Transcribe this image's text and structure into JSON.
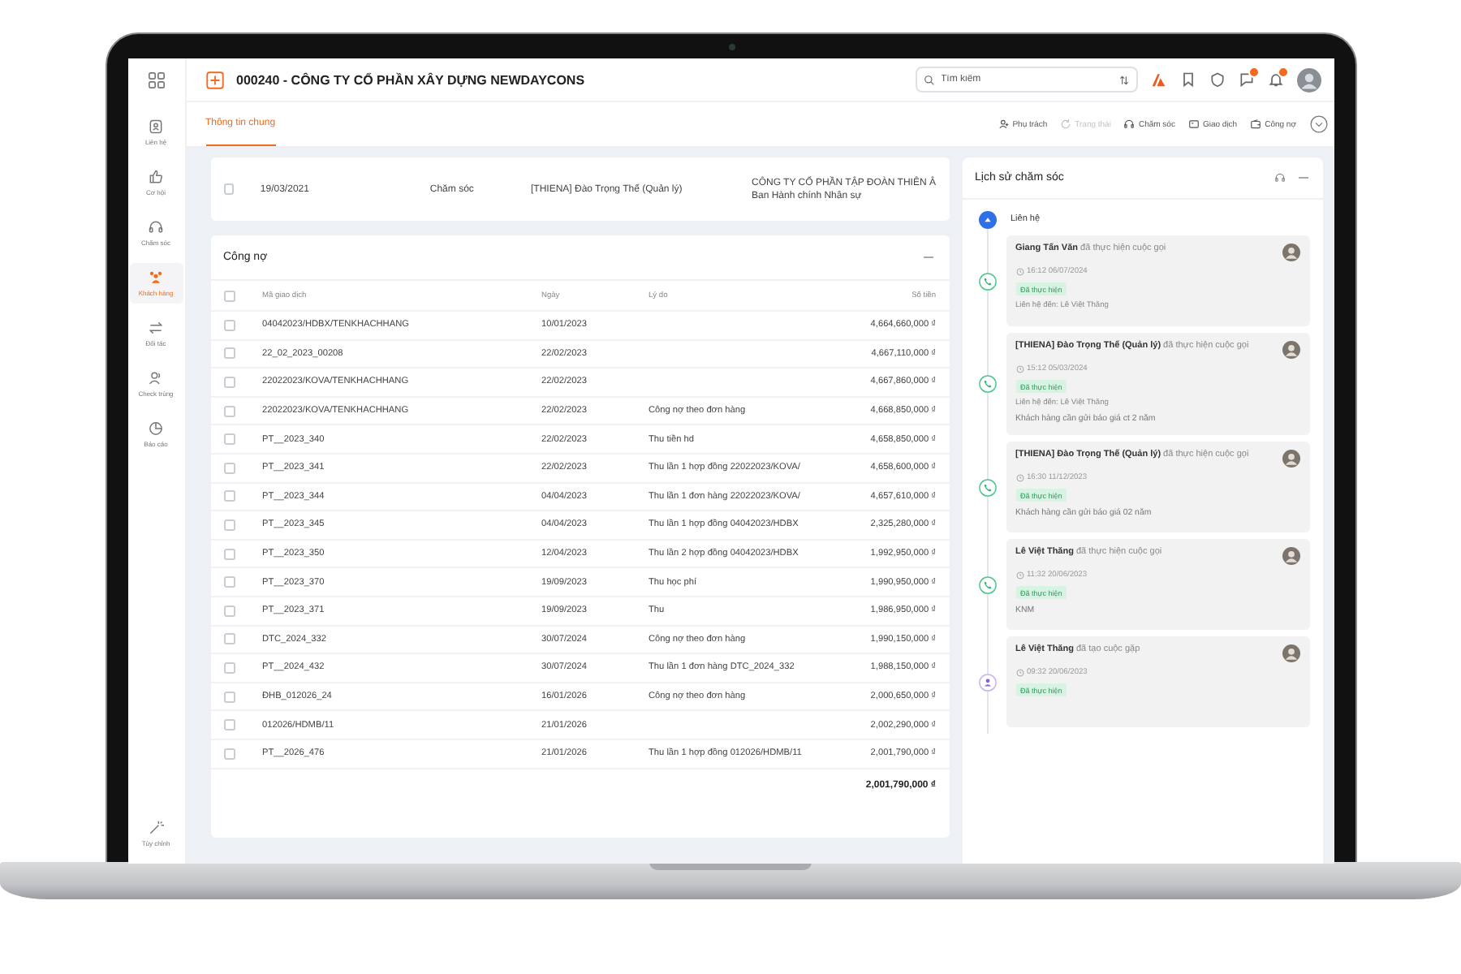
{
  "sidebar": {
    "items": [
      {
        "label": "Liên hệ",
        "kind": "contact",
        "selected": false
      },
      {
        "label": "Cơ hội",
        "kind": "like",
        "selected": false
      },
      {
        "label": "Chăm sóc",
        "kind": "headset",
        "selected": false
      },
      {
        "label": "Khách hàng",
        "kind": "people",
        "selected": true
      },
      {
        "label": "Đối tác",
        "kind": "swap",
        "selected": false
      },
      {
        "label": "Check trùng",
        "kind": "users",
        "selected": false
      },
      {
        "label": "Báo cáo",
        "kind": "chart",
        "selected": false
      }
    ],
    "bottom_item": {
      "label": "Tùy chỉnh"
    }
  },
  "header": {
    "title": "000240 - CÔNG TY CỔ PHẦN XÂY DỰNG NEWDAYCONS",
    "search": {
      "placeholder": "Tìm kiếm"
    }
  },
  "tabs": [
    {
      "label": "Thông tin chung",
      "selected": true
    }
  ],
  "actions": [
    {
      "label": "Phụ trách",
      "kind": "user",
      "disabled": false
    },
    {
      "label": "Trạng thái",
      "kind": "refresh",
      "disabled": true
    },
    {
      "label": "Chăm sóc",
      "kind": "headset",
      "disabled": false
    },
    {
      "label": "Giao dịch",
      "kind": "card",
      "disabled": false
    },
    {
      "label": "Công nợ",
      "kind": "wallet",
      "disabled": false
    }
  ],
  "summary_row": {
    "checked": false,
    "date": "19/03/2021",
    "type": "Chăm sóc",
    "owner": "[THIENA] Đào Trọng Thế (Quản lý)",
    "company": "CÔNG TY CỔ PHẦN TẬP ĐOÀN THIÊN Â",
    "department": "Ban Hành chính Nhân sự"
  },
  "debt": {
    "title": "Công nợ",
    "columns": [
      "Mã giao dịch",
      "Ngày",
      "Lý do",
      "Số tiền"
    ],
    "header_checked": false,
    "rows": [
      {
        "checked": false,
        "code": "04042023/HDBX/TENKHACHHANG",
        "date": "10/01/2023",
        "reason": "",
        "amount": "4,664,660,000 ₫"
      },
      {
        "checked": false,
        "code": "22_02_2023_00208",
        "date": "22/02/2023",
        "reason": "",
        "amount": "4,667,110,000 ₫"
      },
      {
        "checked": false,
        "code": "22022023/KOVA/TENKHACHHANG",
        "date": "22/02/2023",
        "reason": "",
        "amount": "4,667,860,000 ₫"
      },
      {
        "checked": false,
        "code": "22022023/KOVA/TENKHACHHANG",
        "date": "22/02/2023",
        "reason": "Công nợ theo đơn hàng",
        "amount": "4,668,850,000 ₫"
      },
      {
        "checked": false,
        "code": "PT__2023_340",
        "date": "22/02/2023",
        "reason": "Thu tiền hd",
        "amount": "4,658,850,000 ₫"
      },
      {
        "checked": false,
        "code": "PT__2023_341",
        "date": "22/02/2023",
        "reason": "Thu lần 1 hợp đồng 22022023/KOVA/",
        "amount": "4,658,600,000 ₫"
      },
      {
        "checked": false,
        "code": "PT__2023_344",
        "date": "04/04/2023",
        "reason": "Thu lần 1 đơn hàng 22022023/KOVA/",
        "amount": "4,657,610,000 ₫"
      },
      {
        "checked": false,
        "code": "PT__2023_345",
        "date": "04/04/2023",
        "reason": "Thu lần 1 hợp đồng 04042023/HDBX",
        "amount": "2,325,280,000 ₫"
      },
      {
        "checked": false,
        "code": "PT__2023_350",
        "date": "12/04/2023",
        "reason": "Thu lần 2 hợp đồng 04042023/HDBX",
        "amount": "1,992,950,000 ₫"
      },
      {
        "checked": false,
        "code": "PT__2023_370",
        "date": "19/09/2023",
        "reason": "Thu học phí",
        "amount": "1,990,950,000 ₫"
      },
      {
        "checked": false,
        "code": "PT__2023_371",
        "date": "19/09/2023",
        "reason": "Thu",
        "amount": "1,986,950,000 ₫"
      },
      {
        "checked": false,
        "code": "DTC_2024_332",
        "date": "30/07/2024",
        "reason": "Công nợ theo đơn hàng",
        "amount": "1,990,150,000 ₫"
      },
      {
        "checked": false,
        "code": "PT__2024_432",
        "date": "30/07/2024",
        "reason": "Thu lần 1 đơn hàng DTC_2024_332",
        "amount": "1,988,150,000 ₫"
      },
      {
        "checked": false,
        "code": "ĐHB_012026_24",
        "date": "16/01/2026",
        "reason": "Công nợ theo đơn hàng",
        "amount": "2,000,650,000 ₫"
      },
      {
        "checked": false,
        "code": "012026/HDMB/11",
        "date": "21/01/2026",
        "reason": "",
        "amount": "2,002,290,000 ₫"
      },
      {
        "checked": false,
        "code": "PT__2026_476",
        "date": "21/01/2026",
        "reason": "Thu lần 1 hợp đồng 012026/HDMB/11",
        "amount": "2,001,790,000 ₫"
      }
    ],
    "total": "2,001,790,000 ₫"
  },
  "history": {
    "title": "Lịch sử chăm sóc",
    "group": "Liên hệ",
    "entries": [
      {
        "kind": "call",
        "text": "**Giang Tấn Văn** đã thực hiện cuộc gọi",
        "time": "16:12 06/07/2024",
        "status": "Đã thực hiện",
        "contact": "Liên hệ đến: Lê Việt Thăng"
      },
      {
        "kind": "call",
        "text": "**[THIENA] Đào Trọng Thế (Quản lý)** đã thực hiện cuộc gọi",
        "time": "15:12 05/03/2024",
        "status": "Đã thực hiện",
        "contact": "Liên hệ đến: Lê Việt Thăng",
        "note": "Khách hàng cần gửi báo giá ct 2 năm"
      },
      {
        "kind": "call",
        "text": "**[THIENA] Đào Trọng Thế (Quản lý)** đã thực hiện cuộc gọi",
        "time": "16:30 11/12/2023",
        "status": "Đã thực hiện",
        "note": "Khách hàng cần gửi báo giá 02 năm"
      },
      {
        "kind": "call",
        "text": "**Lê Việt Thăng** đã thực hiện cuộc gọi",
        "time": "11:32 20/06/2023",
        "status": "Đã thực hiện",
        "note": "KNM"
      },
      {
        "kind": "meeting",
        "text": "**Lê Việt Thăng** đã tạo cuộc gặp",
        "time": "09:32 20/06/2023",
        "status": "Đã thực hiện"
      }
    ]
  }
}
